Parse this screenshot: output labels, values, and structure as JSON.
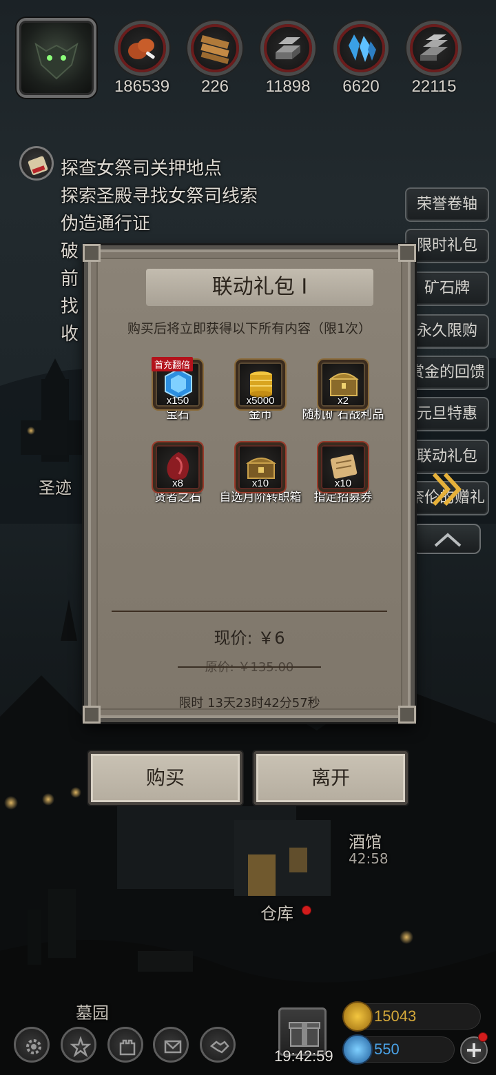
{
  "resources": [
    {
      "icon": "meat-icon",
      "value": "186539"
    },
    {
      "icon": "wood-planks-icon",
      "value": "226"
    },
    {
      "icon": "iron-ingot-icon",
      "value": "11898"
    },
    {
      "icon": "crystal-icon",
      "value": "6620"
    },
    {
      "icon": "steel-bars-icon",
      "value": "22115"
    }
  ],
  "quests": [
    "探查女祭司关押地点",
    "探索圣殿寻找女祭司线索",
    "伪造通行证",
    "破",
    "前",
    "找",
    "收"
  ],
  "side_menu": [
    "荣誉卷轴",
    "限时礼包",
    "矿石牌",
    "永久限购",
    "赏金的回馈",
    "元旦特惠",
    "联动礼包",
    "奈伦的赠礼"
  ],
  "map_labels": {
    "shengji": "圣迹",
    "tavern": "酒馆",
    "tavern_timer": "42:58",
    "warehouse": "仓库",
    "cemetery": "墓园"
  },
  "modal": {
    "title": "联动礼包 I",
    "subtitle": "购买后将立即获得以下所有内容（限1次）",
    "items": [
      {
        "icon": "gem-icon",
        "qty": "x150",
        "name": "宝石",
        "badge": "首充翻倍"
      },
      {
        "icon": "gold-coins-icon",
        "qty": "x5000",
        "name": "金币"
      },
      {
        "icon": "ore-chest-icon",
        "qty": "x2",
        "name": "随机矿石战利品"
      },
      {
        "icon": "sage-stone-icon",
        "qty": "x8",
        "name": "贤者之石"
      },
      {
        "icon": "class-chest-icon",
        "qty": "x10",
        "name": "自选月阶转职箱"
      },
      {
        "icon": "recruit-scroll-icon",
        "qty": "x10",
        "name": "指定招募券"
      }
    ],
    "price_now": "现价: ￥6",
    "price_old": "原价: ￥135.00",
    "timer": "限时 13天23时42分57秒",
    "buy_label": "购买",
    "leave_label": "离开"
  },
  "bottom": {
    "clock": "19:42:59",
    "gold": "15043",
    "gems": "550"
  },
  "colors": {
    "modal_bg": "#847c70",
    "gold_text": "#d4a83a",
    "gem_text": "#4aa3e8",
    "badge_red": "#b3121b"
  }
}
